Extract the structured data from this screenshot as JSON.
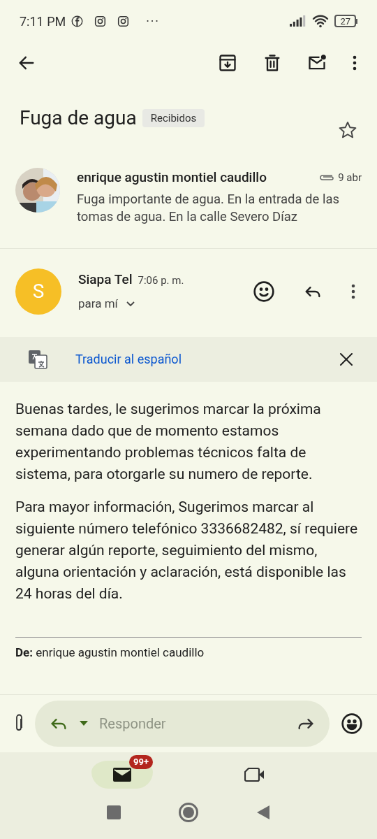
{
  "status_bar": {
    "time": "7:11 PM",
    "more": "···",
    "battery": "27"
  },
  "subject": {
    "title": "Fuga de agua",
    "label": "Recibidos",
    "starred": false
  },
  "previous_message": {
    "sender": "enrique agustin montiel caudillo",
    "has_attachment": true,
    "date": "9 abr",
    "snippet": "Fuga importante de agua. En la entrada de las tomas de agua. En la calle Severo Díaz"
  },
  "message": {
    "avatar_letter": "S",
    "sender": "Siapa Tel",
    "time": "7:06 p. m.",
    "recipient": "para mí"
  },
  "translate_bar": {
    "link": "Traducir al español"
  },
  "body": [
    "Buenas tardes, le sugerimos marcar la próxima semana dado que de momento estamos experimentando problemas técnicos falta de sistema, para otorgarle su numero de reporte.",
    "Para mayor información, Sugerimos marcar al siguiente número telefónico 3336682482, sí requiere generar algún reporte, seguimiento del mismo, alguna orientación y aclaración, está disponible las 24 horas del día."
  ],
  "quoted_from": "**De:** enrique agustin montiel caudillo",
  "reply_bar": {
    "placeholder": "Responder"
  },
  "bottom_nav": [
    {
      "kind": "mail",
      "badge": "99+",
      "selected": true
    },
    {
      "kind": "meet",
      "selected": false
    }
  ]
}
